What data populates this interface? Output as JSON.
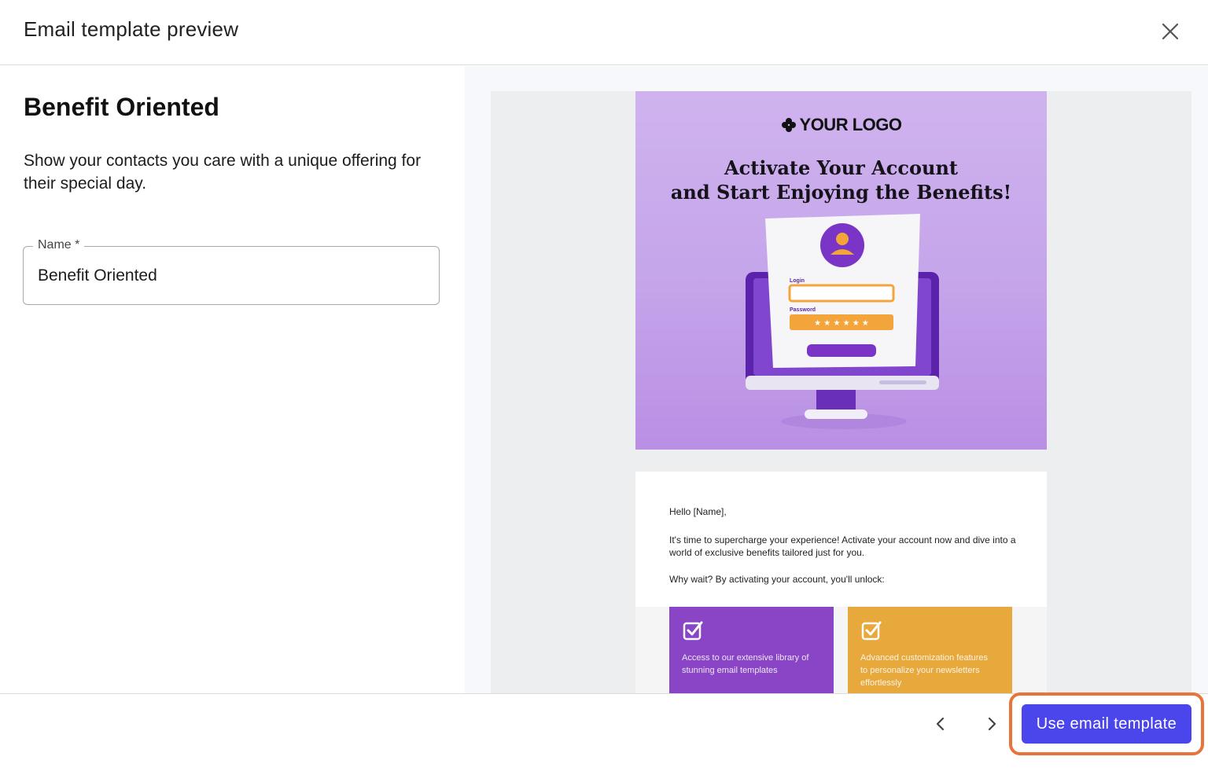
{
  "header": {
    "title": "Email template preview",
    "close_icon": "close-icon"
  },
  "template": {
    "title": "Benefit Oriented",
    "description": "Show your contacts you care with a unique offering for their special day.",
    "name_field": {
      "label": "Name *",
      "value": "Benefit Oriented"
    }
  },
  "preview": {
    "logo": "YOUR LOGO",
    "hero_title_line1": "Activate Your Account",
    "hero_title_line2": "and Start Enjoying the Benefits!",
    "illustration": {
      "login_label": "Login",
      "password_label": "Password",
      "password_mask": "★ ★ ★ ★ ★ ★"
    },
    "greeting": "Hello [Name],",
    "paragraph": "It's time to supercharge your experience! Activate your account now and dive into a world of exclusive benefits tailored just for you.",
    "unlock": "Why wait? By activating your account, you'll unlock:",
    "cards": [
      {
        "text": "Access to our extensive library of stunning email templates",
        "color": "#8a45c6"
      },
      {
        "text": "Advanced customization features to personalize your newsletters effortlessly",
        "color": "#e8a93c"
      }
    ]
  },
  "footer": {
    "use_button": "Use email template",
    "prev_icon": "chevron-left-icon",
    "next_icon": "chevron-right-icon"
  },
  "colors": {
    "primary": "#4b45ec",
    "highlight": "#e8743b",
    "hero_bg": "#c5a4ea"
  }
}
